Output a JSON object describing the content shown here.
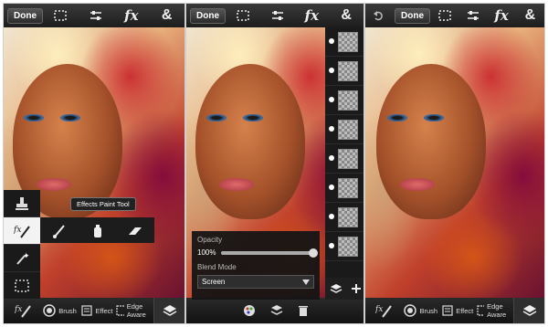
{
  "panels": [
    {
      "topbar": {
        "done_label": "Done",
        "icons": [
          "selection-icon",
          "adjust-icon",
          "fx-icon",
          "ampersand-icon",
          "undo-icon"
        ],
        "fx_text": "fx",
        "amp_text": "&"
      },
      "tooltip": "Effects Paint Tool",
      "bottombar": {
        "items": [
          {
            "label": "Brush",
            "icon": "brush-icon"
          },
          {
            "label": "Effect",
            "icon": "effect-icon"
          },
          {
            "label": "Edge Aware",
            "icon": "edge-aware-icon"
          }
        ]
      }
    },
    {
      "topbar": {
        "done_label": "Done",
        "fx_text": "fx",
        "amp_text": "&"
      },
      "opacity": {
        "label": "Opacity",
        "value": "100%",
        "fraction": 1.0
      },
      "blend": {
        "label": "Blend Mode",
        "selected": "Screen"
      },
      "layers_count": 8
    },
    {
      "topbar": {
        "done_label": "Done",
        "fx_text": "fx",
        "amp_text": "&"
      },
      "bottombar": {
        "items": [
          {
            "label": "Brush",
            "icon": "brush-icon"
          },
          {
            "label": "Effect",
            "icon": "effect-icon"
          },
          {
            "label": "Edge Aware",
            "icon": "edge-aware-icon"
          }
        ]
      }
    }
  ],
  "colors": {
    "bar_dark": "#1d1d1d",
    "accent_white": "#f3f3f3"
  }
}
